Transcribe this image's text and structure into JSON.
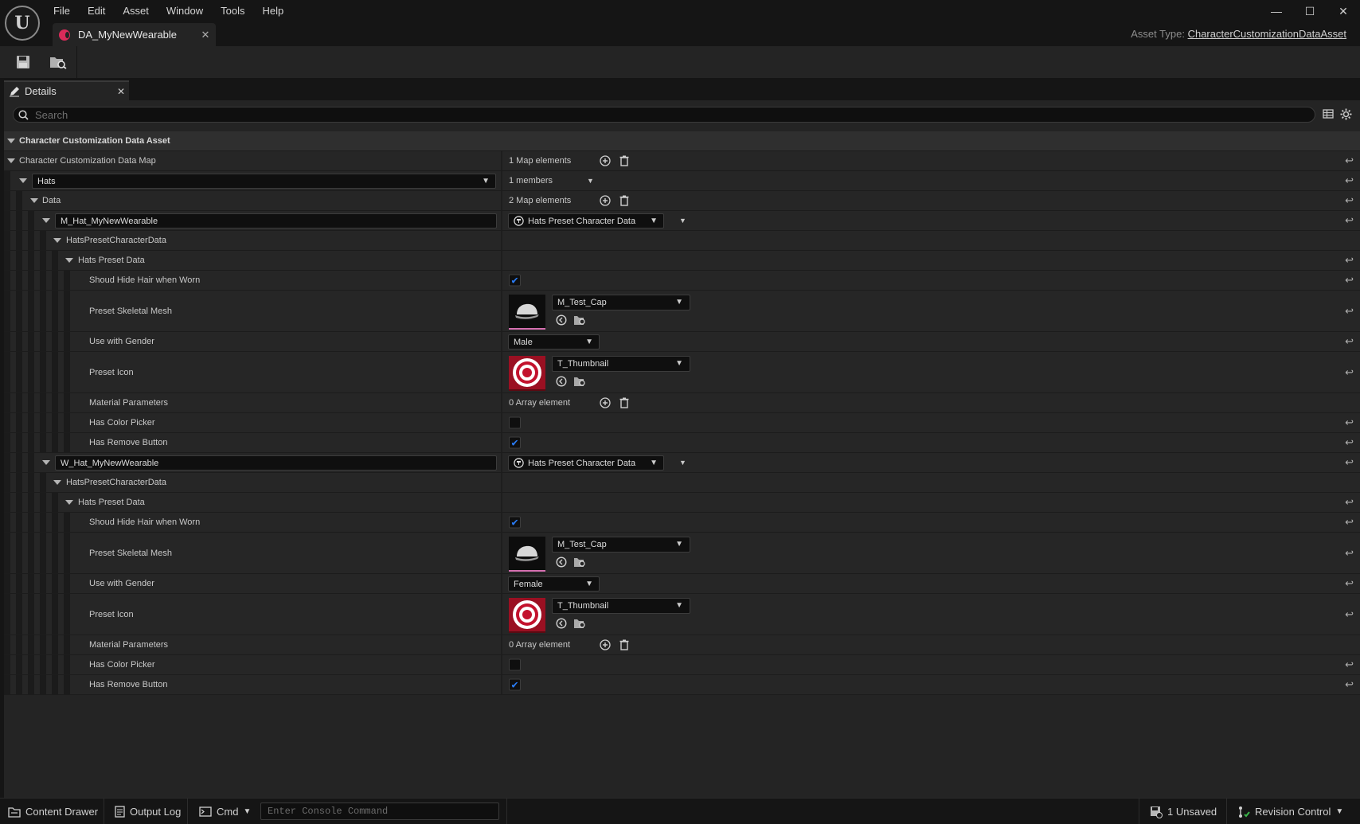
{
  "app": {
    "menu": [
      "File",
      "Edit",
      "Asset",
      "Window",
      "Tools",
      "Help"
    ],
    "doc_tab": "DA_MyNewWearable",
    "asset_type_label": "Asset Type:",
    "asset_type_value": "CharacterCustomizationDataAsset",
    "accent_color": "#d92b5a"
  },
  "details": {
    "tab_label": "Details",
    "search_placeholder": "Search",
    "category": "Character Customization Data Asset",
    "map_label": "Character Customization Data Map",
    "map_count": "1 Map elements",
    "hats_key": "Hats",
    "hats_members": "1 members",
    "data_label": "Data",
    "data_count": "2 Map elements",
    "entries": [
      {
        "key": "M_Hat_MyNewWearable",
        "struct_type": "Hats Preset Character Data",
        "struct_label": "HatsPresetCharacterData",
        "group_label": "Hats Preset Data",
        "hide_hair_label": "Shoud Hide Hair when Worn",
        "hide_hair": true,
        "mesh_label": "Preset Skeletal Mesh",
        "mesh_value": "M_Test_Cap",
        "gender_label": "Use with Gender",
        "gender_value": "Male",
        "icon_label": "Preset Icon",
        "icon_value": "T_Thumbnail",
        "material_label": "Material Parameters",
        "material_count": "0 Array element",
        "color_picker_label": "Has Color Picker",
        "color_picker": false,
        "remove_button_label": "Has Remove Button",
        "remove_button": true
      },
      {
        "key": "W_Hat_MyNewWearable",
        "struct_type": "Hats Preset Character Data",
        "struct_label": "HatsPresetCharacterData",
        "group_label": "Hats Preset Data",
        "hide_hair_label": "Shoud Hide Hair when Worn",
        "hide_hair": true,
        "mesh_label": "Preset Skeletal Mesh",
        "mesh_value": "M_Test_Cap",
        "gender_label": "Use with Gender",
        "gender_value": "Female",
        "icon_label": "Preset Icon",
        "icon_value": "T_Thumbnail",
        "material_label": "Material Parameters",
        "material_count": "0 Array element",
        "color_picker_label": "Has Color Picker",
        "color_picker": false,
        "remove_button_label": "Has Remove Button",
        "remove_button": true
      }
    ]
  },
  "statusbar": {
    "content_drawer": "Content Drawer",
    "output_log": "Output Log",
    "cmd": "Cmd",
    "console_placeholder": "Enter Console Command",
    "unsaved": "1 Unsaved",
    "revision_control": "Revision Control"
  }
}
